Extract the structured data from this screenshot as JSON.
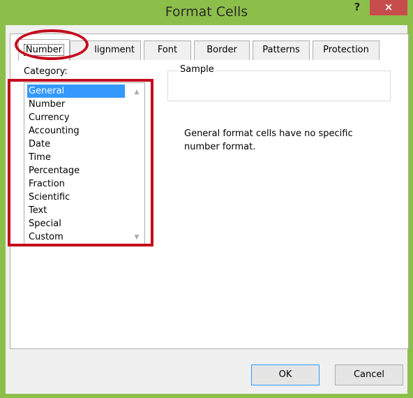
{
  "window": {
    "title": "Format Cells",
    "help_label": "?",
    "close_label": "×",
    "frame_color": "#8cbf4a",
    "close_color": "#c74c4c"
  },
  "tabs": [
    {
      "label": "Number",
      "active": true
    },
    {
      "label": "lignment",
      "active": false
    },
    {
      "label": "Font",
      "active": false
    },
    {
      "label": "Border",
      "active": false
    },
    {
      "label": "Patterns",
      "active": false
    },
    {
      "label": "Protection",
      "active": false
    }
  ],
  "category": {
    "label": "Category:",
    "items": [
      "General",
      "Number",
      "Currency",
      "Accounting",
      "Date",
      "Time",
      "Percentage",
      "Fraction",
      "Scientific",
      "Text",
      "Special",
      "Custom"
    ],
    "selected": "General",
    "selection_color": "#3399ff",
    "scroll_up_icon": "chevron-up-icon",
    "scroll_down_icon": "chevron-down-icon"
  },
  "sample": {
    "label": "Sample",
    "value": ""
  },
  "description": "General format cells have no specific number format.",
  "buttons": {
    "ok": "OK",
    "cancel": "Cancel"
  },
  "annotations": {
    "color": "#c40c1e"
  }
}
